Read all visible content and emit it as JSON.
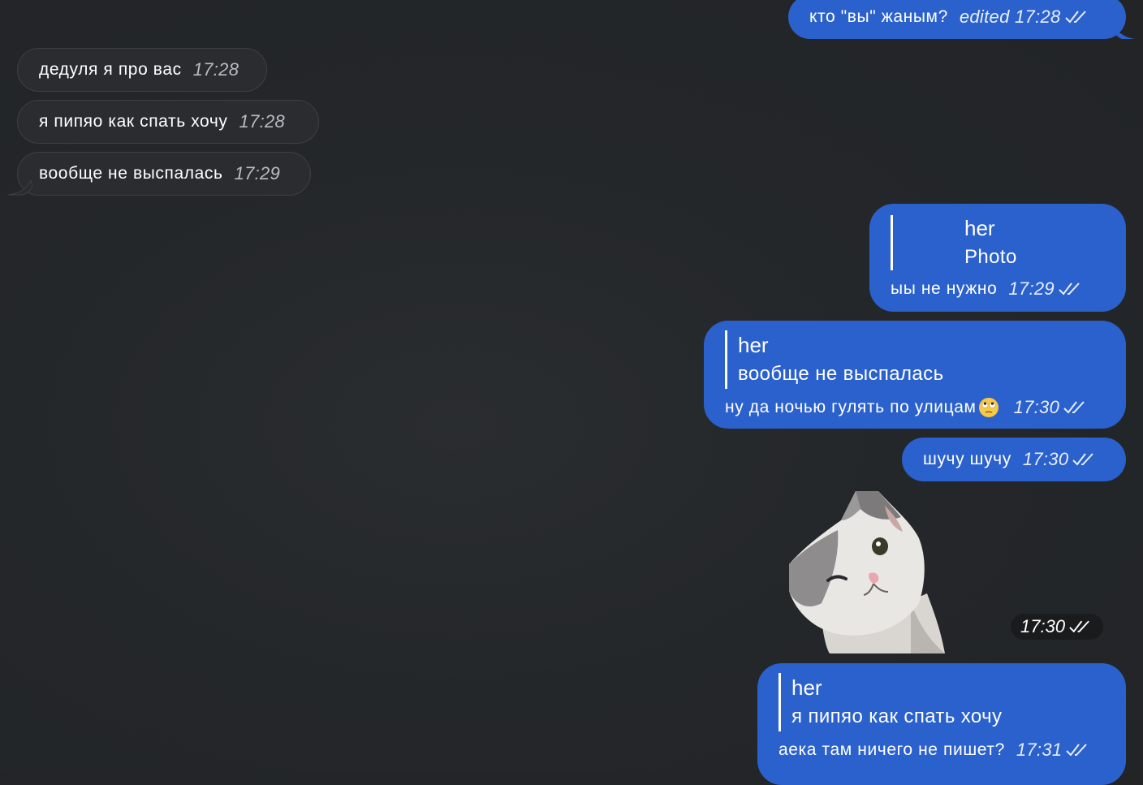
{
  "colors": {
    "background": "#24272a",
    "incoming_bubble": "#2a2c2f",
    "outgoing_bubble": "#2b61cc"
  },
  "messages": [
    {
      "direction": "out",
      "text": "кто \"вы\" жаным?",
      "time": "edited 17:28"
    },
    {
      "direction": "in",
      "text": "дедуля я про вас",
      "time": "17:28"
    },
    {
      "direction": "in",
      "text": "я пипяо как спать хочу",
      "time": "17:28"
    },
    {
      "direction": "in",
      "text": "вообще не выспалась",
      "time": "17:29"
    },
    {
      "direction": "out",
      "reply_to": {
        "name": "her",
        "text": "Photo"
      },
      "text": "ыы не нужно",
      "time": "17:29"
    },
    {
      "direction": "out",
      "reply_to": {
        "name": "her",
        "text": "вообще не выспалась"
      },
      "text": "ну да ночью гулять по улицам",
      "emoji": "face-with-rolling-eyes",
      "time": "17:30"
    },
    {
      "direction": "out",
      "text": "шучу шучу",
      "time": "17:30"
    },
    {
      "direction": "out",
      "sticker": "winking-cat-sticker",
      "time": "17:30"
    },
    {
      "direction": "out",
      "reply_to": {
        "name": "her",
        "text": "я пипяо как спать хочу"
      },
      "text": "аека там ничего не пишет?",
      "time": "17:31"
    }
  ]
}
